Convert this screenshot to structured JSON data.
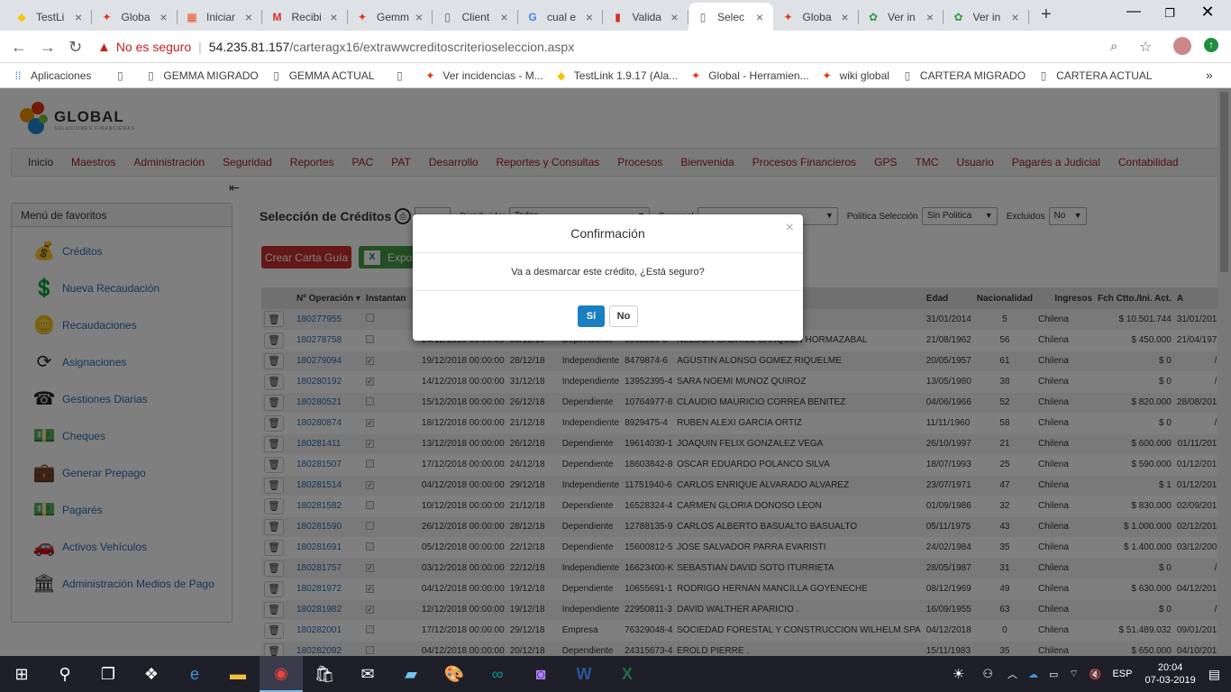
{
  "browser": {
    "tabs": [
      {
        "title": "TestLi",
        "icon": "testlink-icon",
        "active": false
      },
      {
        "title": "Globa",
        "icon": "global-icon",
        "active": false
      },
      {
        "title": "Iniciar",
        "icon": "microsoft-icon",
        "active": false
      },
      {
        "title": "Recibi",
        "icon": "gmail-icon",
        "active": false
      },
      {
        "title": "Gemm",
        "icon": "global-icon",
        "active": false
      },
      {
        "title": "Client",
        "icon": "page-icon",
        "active": false
      },
      {
        "title": "cual e",
        "icon": "google-icon",
        "active": false
      },
      {
        "title": "Valida",
        "icon": "chile-flag-icon",
        "active": false
      },
      {
        "title": "Selec",
        "icon": "page-icon",
        "active": true
      },
      {
        "title": "Globa",
        "icon": "global-icon",
        "active": false
      },
      {
        "title": "Ver in",
        "icon": "bug-icon",
        "active": false
      },
      {
        "title": "Ver in",
        "icon": "bug-icon",
        "active": false
      }
    ],
    "security_label": "No es seguro",
    "url_host": "54.235.81.157",
    "url_path": "/carteragx16/extrawwcreditoscriterioseleccion.aspx",
    "bookmarks": [
      {
        "label": "Aplicaciones",
        "icon": "apps-icon"
      },
      {
        "label": "",
        "icon": "page-icon"
      },
      {
        "label": "GEMMA MIGRADO",
        "icon": "page-icon"
      },
      {
        "label": "GEMMA ACTUAL",
        "icon": "page-icon"
      },
      {
        "label": "",
        "icon": "page-icon"
      },
      {
        "label": "Ver incidencias - M...",
        "icon": "global-icon"
      },
      {
        "label": "TestLink 1.9.17 (Ala...",
        "icon": "testlink-icon"
      },
      {
        "label": "Global - Herramien...",
        "icon": "global-icon"
      },
      {
        "label": "wiki global",
        "icon": "global-icon"
      },
      {
        "label": "CARTERA MIGRADO",
        "icon": "page-icon"
      },
      {
        "label": "CARTERA ACTUAL",
        "icon": "page-icon"
      }
    ]
  },
  "app": {
    "logo_text": "GLOBAL",
    "logo_subtext": "SOLUCIONES FINANCIERAS",
    "menu": [
      "Inicio",
      "Maestros",
      "Administración",
      "Seguridad",
      "Reportes",
      "PAC",
      "PAT",
      "Desarrollo",
      "Reportes y Consultas",
      "Procesos",
      "Bienvenida",
      "Procesos Financieros",
      "GPS",
      "TMC",
      "Usuario",
      "Pagarés a Judicial",
      "Contabilidad"
    ],
    "sidebar": {
      "title": "Menú de favoritos",
      "items": [
        {
          "label": "Créditos",
          "icon": "money-bag-icon"
        },
        {
          "label": "Nueva Recaudación",
          "icon": "money-hand-icon"
        },
        {
          "label": "Recaudaciones",
          "icon": "coins-hand-icon"
        },
        {
          "label": "Asignaciones",
          "icon": "refresh-icon"
        },
        {
          "label": "Gestiones Diarias",
          "icon": "phone-icon"
        },
        {
          "label": "Cheques",
          "icon": "money-icon"
        },
        {
          "label": "Generar Prepago",
          "icon": "briefcase-icon"
        },
        {
          "label": "Pagarés",
          "icon": "money-icon"
        },
        {
          "label": "Activos Vehículos",
          "icon": "car-icon"
        },
        {
          "label": "Administración Medios de Pago",
          "icon": "bank-icon"
        }
      ]
    },
    "page_title": "Selección de Créditos",
    "filters": {
      "distribuidor_label": "Distribuidor",
      "distribuidor_value": "Todos",
      "sucursal_label": "Sucursal",
      "sucursal_value": "",
      "politica_label": "Política Selección",
      "politica_value": "Sin Politica",
      "excluidos_label": "Excluidos",
      "excluidos_value": "No"
    },
    "buttons": {
      "crear_carta": "Crear Carta Guía",
      "exportar": "Expor"
    },
    "table": {
      "headers": [
        "",
        "Nº Operación ▾",
        "Instantan",
        "",
        "",
        "",
        "",
        "",
        "Fch. Nac.",
        "Edad",
        "Nacionalidad",
        "Ingresos",
        "Fch Ctto./Ini. Act.",
        "A"
      ],
      "rows": [
        {
          "op": "180277955",
          "chk": "",
          "fecha": "",
          "fch": "",
          "tipo": "",
          "rut": "",
          "nombre": "TADA",
          "nac": "31/01/2014",
          "edad": "5",
          "nacionalidad": "Chilena",
          "ingresos": "$ 10.501.744",
          "ctto": "31/01/2014"
        },
        {
          "op": "180278758",
          "chk": "",
          "fecha": "24/12/2018 00:00:00",
          "fch": "30/12/18",
          "tipo": "Dependiente",
          "rut": "9098239-8",
          "nombre": "NELSON GABRIEL CARQUEN HORMAZABAL",
          "nac": "21/08/1962",
          "edad": "56",
          "nacionalidad": "Chilena",
          "ingresos": "$ 450.000",
          "ctto": "21/04/1977"
        },
        {
          "op": "180279094",
          "chk": "✓",
          "fecha": "19/12/2018 00:00:00",
          "fch": "28/12/18",
          "tipo": "Independiente",
          "rut": "8479874-6",
          "nombre": "AGUSTIN ALONSO GOMEZ RIQUELME",
          "nac": "20/05/1957",
          "edad": "61",
          "nacionalidad": "Chilena",
          "ingresos": "$ 0",
          "ctto": "/ /"
        },
        {
          "op": "180280192",
          "chk": "✓",
          "fecha": "14/12/2018 00:00:00",
          "fch": "31/12/18",
          "tipo": "Independiente",
          "rut": "13952395-4",
          "nombre": "SARA NOEMI MUNOZ QUIROZ",
          "nac": "13/05/1980",
          "edad": "38",
          "nacionalidad": "Chilena",
          "ingresos": "$ 0",
          "ctto": "/ /"
        },
        {
          "op": "180280521",
          "chk": "",
          "fecha": "15/12/2018 00:00:00",
          "fch": "26/12/18",
          "tipo": "Dependiente",
          "rut": "10764977-8",
          "nombre": "CLAUDIO MAURICIO CORREA BENITEZ",
          "nac": "04/06/1966",
          "edad": "52",
          "nacionalidad": "Chilena",
          "ingresos": "$ 820.000",
          "ctto": "28/08/2015"
        },
        {
          "op": "180280874",
          "chk": "✓",
          "fecha": "18/12/2018 00:00:00",
          "fch": "21/12/18",
          "tipo": "Independiente",
          "rut": "8929475-4",
          "nombre": "RUBEN ALEXI GARCIA ORTIZ",
          "nac": "11/11/1960",
          "edad": "58",
          "nacionalidad": "Chilena",
          "ingresos": "$ 0",
          "ctto": "/ /"
        },
        {
          "op": "180281411",
          "chk": "✓",
          "fecha": "13/12/2018 00:00:00",
          "fch": "26/12/18",
          "tipo": "Dependiente",
          "rut": "19614030-1",
          "nombre": "JOAQUIN FELIX GONZALEZ VEGA",
          "nac": "26/10/1997",
          "edad": "21",
          "nacionalidad": "Chilena",
          "ingresos": "$ 600.000",
          "ctto": "01/11/2017"
        },
        {
          "op": "180281507",
          "chk": "",
          "fecha": "17/12/2018 00:00:00",
          "fch": "24/12/18",
          "tipo": "Dependiente",
          "rut": "18603842-8",
          "nombre": "OSCAR EDUARDO POLANCO SILVA",
          "nac": "18/07/1993",
          "edad": "25",
          "nacionalidad": "Chilena",
          "ingresos": "$ 590.000",
          "ctto": "01/12/2017"
        },
        {
          "op": "180281514",
          "chk": "✓",
          "fecha": "04/12/2018 00:00:00",
          "fch": "29/12/18",
          "tipo": "Independiente",
          "rut": "11751940-6",
          "nombre": "CARLOS ENRIQUE ALVARADO ALVAREZ",
          "nac": "23/07/1971",
          "edad": "47",
          "nacionalidad": "Chilena",
          "ingresos": "$ 1",
          "ctto": "01/12/2017"
        },
        {
          "op": "180281582",
          "chk": "",
          "fecha": "10/12/2018 00:00:00",
          "fch": "21/12/18",
          "tipo": "Dependiente",
          "rut": "16528324-4",
          "nombre": "CARMEN GLORIA DONOSO LEON",
          "nac": "01/09/1986",
          "edad": "32",
          "nacionalidad": "Chilena",
          "ingresos": "$ 830.000",
          "ctto": "02/09/2017"
        },
        {
          "op": "180281590",
          "chk": "",
          "fecha": "26/12/2018 00:00:00",
          "fch": "28/12/18",
          "tipo": "Dependiente",
          "rut": "12788135-9",
          "nombre": "CARLOS ALBERTO BASUALTO BASUALTO",
          "nac": "05/11/1975",
          "edad": "43",
          "nacionalidad": "Chilena",
          "ingresos": "$ 1.000.000",
          "ctto": "02/12/2014"
        },
        {
          "op": "180281691",
          "chk": "",
          "fecha": "05/12/2018 00:00:00",
          "fch": "22/12/18",
          "tipo": "Dependiente",
          "rut": "15600812-5",
          "nombre": "JOSE SALVADOR PARRA EVARISTI",
          "nac": "24/02/1984",
          "edad": "35",
          "nacionalidad": "Chilena",
          "ingresos": "$ 1.400.000",
          "ctto": "03/12/2006"
        },
        {
          "op": "180281757",
          "chk": "✓",
          "fecha": "03/12/2018 00:00:00",
          "fch": "22/12/18",
          "tipo": "Independiente",
          "rut": "16623400-K",
          "nombre": "SEBASTIAN DAVID SOTO ITURRIETA",
          "nac": "28/05/1987",
          "edad": "31",
          "nacionalidad": "Chilena",
          "ingresos": "$ 0",
          "ctto": "/ /"
        },
        {
          "op": "180281972",
          "chk": "✓",
          "fecha": "04/12/2018 00:00:00",
          "fch": "19/12/18",
          "tipo": "Dependiente",
          "rut": "10655691-1",
          "nombre": "RODRIGO HERNAN MANCILLA GOYENECHE",
          "nac": "08/12/1969",
          "edad": "49",
          "nacionalidad": "Chilena",
          "ingresos": "$ 630.000",
          "ctto": "04/12/2016"
        },
        {
          "op": "180281982",
          "chk": "✓",
          "fecha": "12/12/2018 00:00:00",
          "fch": "19/12/18",
          "tipo": "Independiente",
          "rut": "22950811-3",
          "nombre": "DAVID WALTHER APARICIO .",
          "nac": "16/09/1955",
          "edad": "63",
          "nacionalidad": "Chilena",
          "ingresos": "$ 0",
          "ctto": "/ /"
        },
        {
          "op": "180282001",
          "chk": "",
          "fecha": "17/12/2018 00:00:00",
          "fch": "29/12/18",
          "tipo": "Empresa",
          "rut": "76329048-4",
          "nombre": "SOCIEDAD FORESTAL Y CONSTRUCCION WILHELM SPA",
          "nac": "04/12/2018",
          "edad": "0",
          "nacionalidad": "Chilena",
          "ingresos": "$ 51.489.032",
          "ctto": "09/01/2014"
        },
        {
          "op": "180282092",
          "chk": "",
          "fecha": "04/12/2018 00:00:00",
          "fch": "20/12/18",
          "tipo": "Dependiente",
          "rut": "24315673-4",
          "nombre": "EROLD PIERRE .",
          "nac": "15/11/1983",
          "edad": "35",
          "nacionalidad": "Chilena",
          "ingresos": "$ 650.000",
          "ctto": "04/10/2016"
        }
      ]
    }
  },
  "modal": {
    "title": "Confirmación",
    "message": "Va a desmarcar este crédito, ¿Está seguro?",
    "yes_label": "Sí",
    "no_label": "No",
    "close_label": "×"
  },
  "taskbar": {
    "lang": "ESP",
    "time": "20:04",
    "date": "07-03-2019"
  }
}
